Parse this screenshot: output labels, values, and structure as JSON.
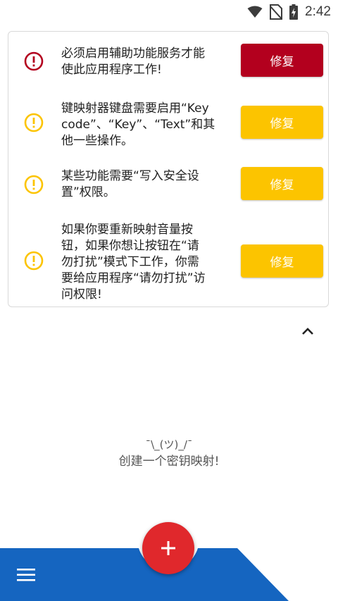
{
  "status_bar": {
    "time": "2:42",
    "icons": [
      "wifi-icon",
      "no-sim-icon",
      "battery-charging-icon"
    ]
  },
  "colors": {
    "error": "#b3001e",
    "warning": "#fcc400",
    "fab": "#e0282c",
    "bottom_bar": "#1565c0"
  },
  "fix_list": {
    "items": [
      {
        "icon": "error-icon",
        "text_lines": [
          "必须启用辅助功能服务才能",
          "使此应用程序工作!"
        ],
        "button": "修复",
        "severity": "error"
      },
      {
        "icon": "warning-icon",
        "text_lines": [
          "键映射器键盘需要启用“Key",
          "code”、“Key”、“Text”和其",
          "他一些操作。"
        ],
        "button": "修复",
        "severity": "warning"
      },
      {
        "icon": "warning-icon",
        "text_lines": [
          "某些功能需要“写入安全设",
          "置”权限。"
        ],
        "button": "修复",
        "severity": "warning"
      },
      {
        "icon": "warning-icon",
        "text_lines": [
          "如果你要重新映射音量按",
          "钮，如果你想让按钮在“请",
          "勿打扰”模式下工作，你需",
          "要给应用程序“请勿打扰”访",
          "问权限!"
        ],
        "button": "修复",
        "severity": "warning"
      }
    ]
  },
  "empty_state": {
    "face": "¯\\_(ツ)_/¯",
    "message": "创建一个密钥映射!"
  },
  "bottom_bar": {
    "menu_icon": "menu-icon",
    "fab_icon": "plus-icon"
  }
}
